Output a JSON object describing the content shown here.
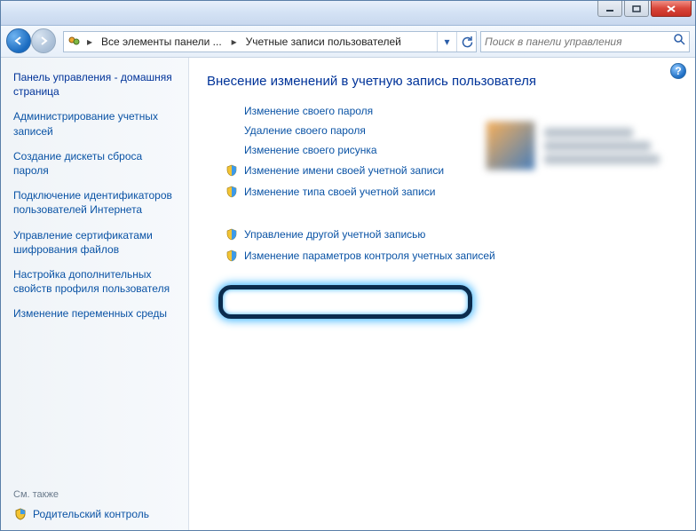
{
  "breadcrumb": {
    "seg1": "Все элементы панели ...",
    "seg2": "Учетные записи пользователей"
  },
  "search": {
    "placeholder": "Поиск в панели управления"
  },
  "sidebar": {
    "title": "Панель управления - домашняя страница",
    "links": [
      "Администрирование учетных записей",
      "Создание дискеты сброса пароля",
      "Подключение идентификаторов пользователей Интернета",
      "Управление сертификатами шифрования файлов",
      "Настройка дополнительных свойств профиля пользователя",
      "Изменение переменных среды"
    ],
    "see_also": "См. также",
    "parental": "Родительский контроль"
  },
  "content": {
    "title": "Внесение изменений в учетную запись пользователя",
    "options": [
      {
        "label": "Изменение своего пароля",
        "shield": false
      },
      {
        "label": "Удаление своего пароля",
        "shield": false
      },
      {
        "label": "Изменение своего рисунка",
        "shield": false
      },
      {
        "label": "Изменение имени своей учетной записи",
        "shield": true
      },
      {
        "label": "Изменение типа своей учетной записи",
        "shield": true
      },
      {
        "label": "Управление другой учетной записью",
        "shield": true
      },
      {
        "label": "Изменение параметров контроля учетных записей",
        "shield": true
      }
    ]
  }
}
